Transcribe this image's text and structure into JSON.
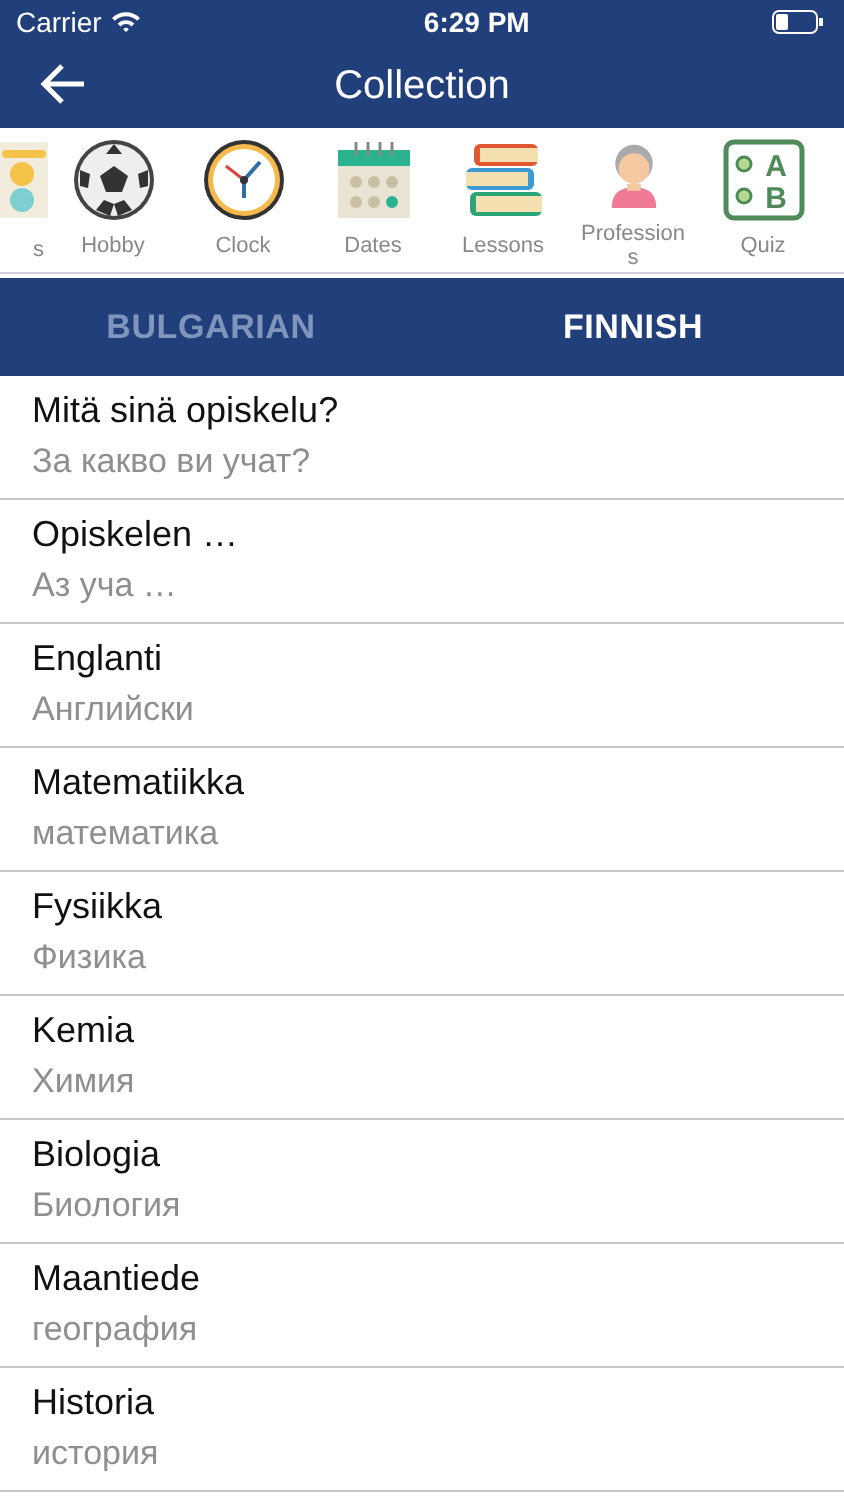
{
  "status_bar": {
    "carrier": "Carrier",
    "time": "6:29 PM"
  },
  "nav": {
    "title": "Collection"
  },
  "categories": [
    {
      "label": "s",
      "kind": "cards"
    },
    {
      "label": "Hobby",
      "kind": "ball"
    },
    {
      "label": "Clock",
      "kind": "clock"
    },
    {
      "label": "Dates",
      "kind": "calendar"
    },
    {
      "label": "Lessons",
      "kind": "books"
    },
    {
      "label": "Professions",
      "kind": "person"
    },
    {
      "label": "Quiz",
      "kind": "quiz",
      "icon_text": [
        "A",
        "B"
      ]
    }
  ],
  "tabs": [
    {
      "label": "BULGARIAN",
      "selected": false
    },
    {
      "label": "FINNISH",
      "selected": true
    }
  ],
  "phrases": [
    {
      "primary": "Mitä sinä opiskelu?",
      "secondary": "За какво ви учат?"
    },
    {
      "primary": "Opiskelen …",
      "secondary": "Аз уча …"
    },
    {
      "primary": "Englanti",
      "secondary": "Английски"
    },
    {
      "primary": "Matematiikka",
      "secondary": "математика"
    },
    {
      "primary": "Fysiikka",
      "secondary": "Физика"
    },
    {
      "primary": "Kemia",
      "secondary": "Химия"
    },
    {
      "primary": "Biologia",
      "secondary": "Биология"
    },
    {
      "primary": "Maantiede",
      "secondary": "география"
    },
    {
      "primary": "Historia",
      "secondary": "история"
    }
  ]
}
